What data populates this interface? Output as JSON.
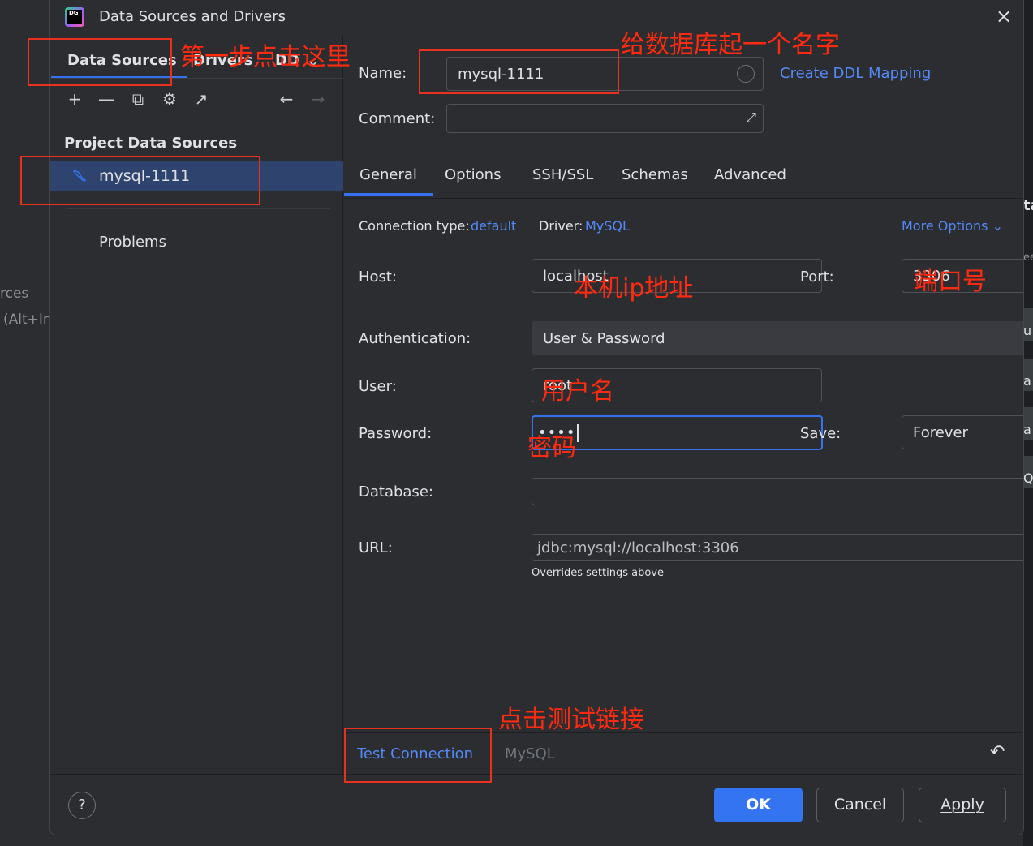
{
  "background": {
    "left_text_1": "rces",
    "left_text_2": "(Alt+In",
    "right_text_1": "ta",
    "right_text_2": "ee",
    "right_text_3": "u",
    "right_text_4": "a",
    "right_text_5": "a",
    "right_text_6": "QL"
  },
  "window": {
    "title": "Data Sources and Drivers",
    "logo_text": "DG",
    "close_icon": "×"
  },
  "left": {
    "tabs": [
      "Data Sources",
      "Drivers",
      "DD"
    ],
    "section_title": "Project Data Sources",
    "data_source": "mysql-1111",
    "problems": "Problems",
    "tools": {
      "add": "+",
      "remove": "—",
      "copy": "⧉",
      "settings": "⚙",
      "open": "↗",
      "back": "←",
      "forward": "→",
      "dropdown": "⌄"
    }
  },
  "form": {
    "name_label": "Name:",
    "name_value": "mysql-1111",
    "ddl_link": "Create DDL Mapping",
    "comment_label": "Comment:",
    "comment_value": "",
    "tabs": [
      "General",
      "Options",
      "SSH/SSL",
      "Schemas",
      "Advanced"
    ],
    "connection_type_label": "Connection type:",
    "connection_type_value": "default",
    "driver_label": "Driver:",
    "driver_value": "MySQL",
    "more_options": "More Options",
    "host_label": "Host:",
    "host_value": "localhost",
    "port_label": "Port:",
    "port_value": "3306",
    "auth_label": "Authentication:",
    "auth_value": "User & Password",
    "user_label": "User:",
    "user_value": "root",
    "password_label": "Password:",
    "password_value": "••••",
    "save_label": "Save:",
    "save_value": "Forever",
    "database_label": "Database:",
    "database_value": "",
    "url_label": "URL:",
    "url_value": "jdbc:mysql://localhost:3306",
    "url_hint": "Overrides settings above"
  },
  "bottom": {
    "test_connection": "Test Connection",
    "driver_status": "MySQL",
    "revert_icon": "↶",
    "help": "?",
    "ok": "OK",
    "cancel": "Cancel",
    "apply": "Apply"
  },
  "annotations": {
    "step1": "第一步点击这里",
    "name": "给数据库起一个名字",
    "host": "本机ip地址",
    "port": "端口号",
    "user": "用户名",
    "password": "密码",
    "test": "点击测试链接"
  },
  "colors": {
    "accent": "#3574f0",
    "link": "#548af7",
    "annotation_red": "#e8321e",
    "background": "#2b2d30"
  }
}
